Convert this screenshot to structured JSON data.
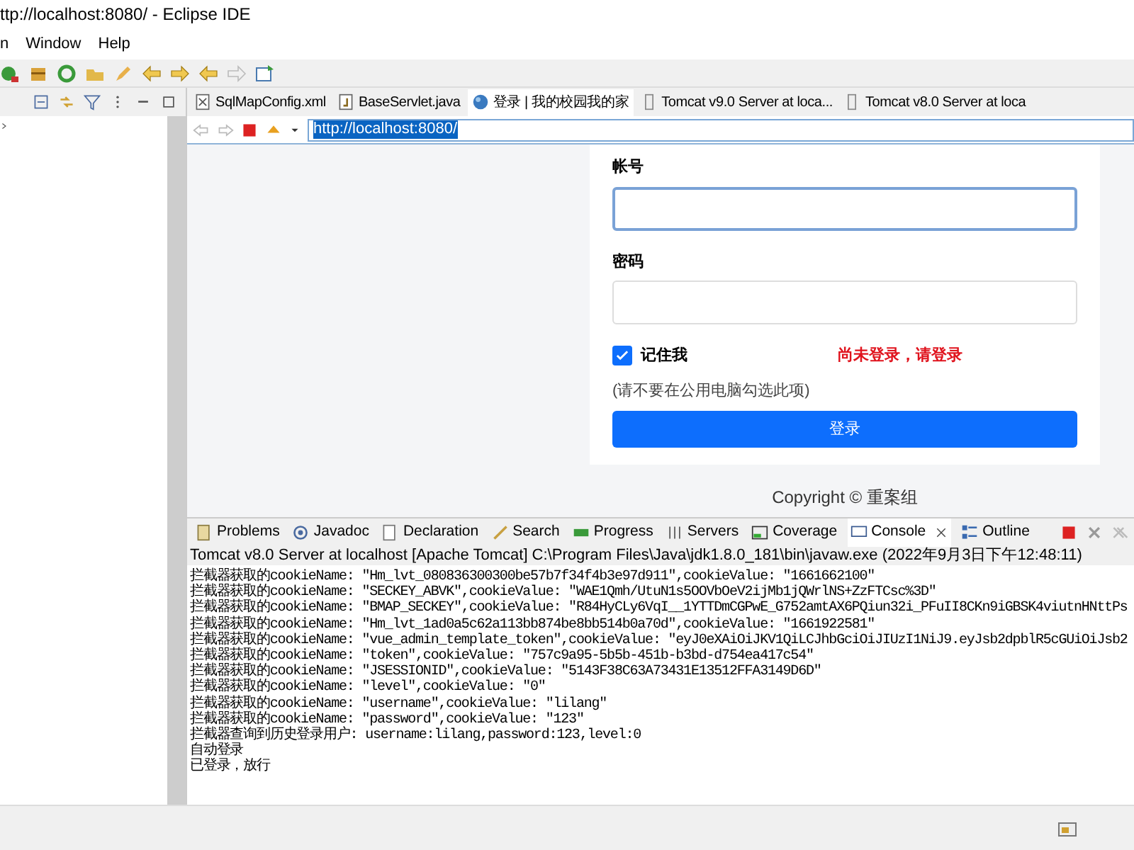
{
  "window": {
    "title": "ttp://localhost:8080/ - Eclipse IDE"
  },
  "menu": [
    "n",
    "Window",
    "Help"
  ],
  "editor_tabs": [
    {
      "label": "SqlMapConfig.xml",
      "kind": "xml",
      "selected": false
    },
    {
      "label": "BaseServlet.java",
      "kind": "java",
      "selected": false
    },
    {
      "label": "登录 | 我的校园我的家",
      "kind": "web",
      "selected": true
    },
    {
      "label": "Tomcat v9.0 Server at loca...",
      "kind": "server",
      "selected": false
    },
    {
      "label": "Tomcat v8.0 Server at loca",
      "kind": "server",
      "selected": false
    }
  ],
  "browser": {
    "url": "http://localhost:8080/",
    "login_form": {
      "account_label": "帐号",
      "password_label": "密码",
      "remember": {
        "label": "记住我",
        "checked": true
      },
      "status_message": "尚未登录，请登录",
      "hint": "(请不要在公用电脑勾选此项)",
      "submit": "登录"
    },
    "footer": "Copyright © 重案组"
  },
  "bottom_tabs": [
    {
      "label": "Problems",
      "selected": false
    },
    {
      "label": "Javadoc",
      "selected": false
    },
    {
      "label": "Declaration",
      "selected": false
    },
    {
      "label": "Search",
      "selected": false
    },
    {
      "label": "Progress",
      "selected": false
    },
    {
      "label": "Servers",
      "selected": false
    },
    {
      "label": "Coverage",
      "selected": false
    },
    {
      "label": "Console",
      "selected": true
    },
    {
      "label": "Outline",
      "selected": false
    }
  ],
  "console": {
    "description": "Tomcat v8.0 Server at localhost [Apache Tomcat] C:\\Program Files\\Java\\jdk1.8.0_181\\bin\\javaw.exe  (2022年9月3日下午12:48:11)",
    "lines": [
      "拦截器获取的cookieName: \"Hm_lvt_080836300300be57b7f34f4b3e97d911\",cookieValue: \"1661662100\"",
      "拦截器获取的cookieName: \"SECKEY_ABVK\",cookieValue: \"WAE1Qmh/UtuN1s5OOVbOeV2ijMb1jQWrlNS+ZzFTCsc%3D\"",
      "拦截器获取的cookieName: \"BMAP_SECKEY\",cookieValue: \"R84HyCLy6VqI__1YTTDmCGPwE_G752amtAX6PQiun32i_PFuII8CKn9iGBSK4viutnHNttPs",
      "拦截器获取的cookieName: \"Hm_lvt_1ad0a5c62a113bb874be8bb514b0a70d\",cookieValue: \"1661922581\"",
      "拦截器获取的cookieName: \"vue_admin_template_token\",cookieValue: \"eyJ0eXAiOiJKV1QiLCJhbGciOiJIUzI1NiJ9.eyJsb2dpblR5cGUiOiJsb2",
      "拦截器获取的cookieName: \"token\",cookieValue: \"757c9a95-5b5b-451b-b3bd-d754ea417c54\"",
      "拦截器获取的cookieName: \"JSESSIONID\",cookieValue: \"5143F38C63A73431E13512FFA3149D6D\"",
      "拦截器获取的cookieName: \"level\",cookieValue: \"0\"",
      "拦截器获取的cookieName: \"username\",cookieValue: \"lilang\"",
      "拦截器获取的cookieName: \"password\",cookieValue: \"123\"",
      "拦截器查询到历史登录用户: username:lilang,password:123,level:0",
      "自动登录",
      "已登录，放行"
    ]
  }
}
